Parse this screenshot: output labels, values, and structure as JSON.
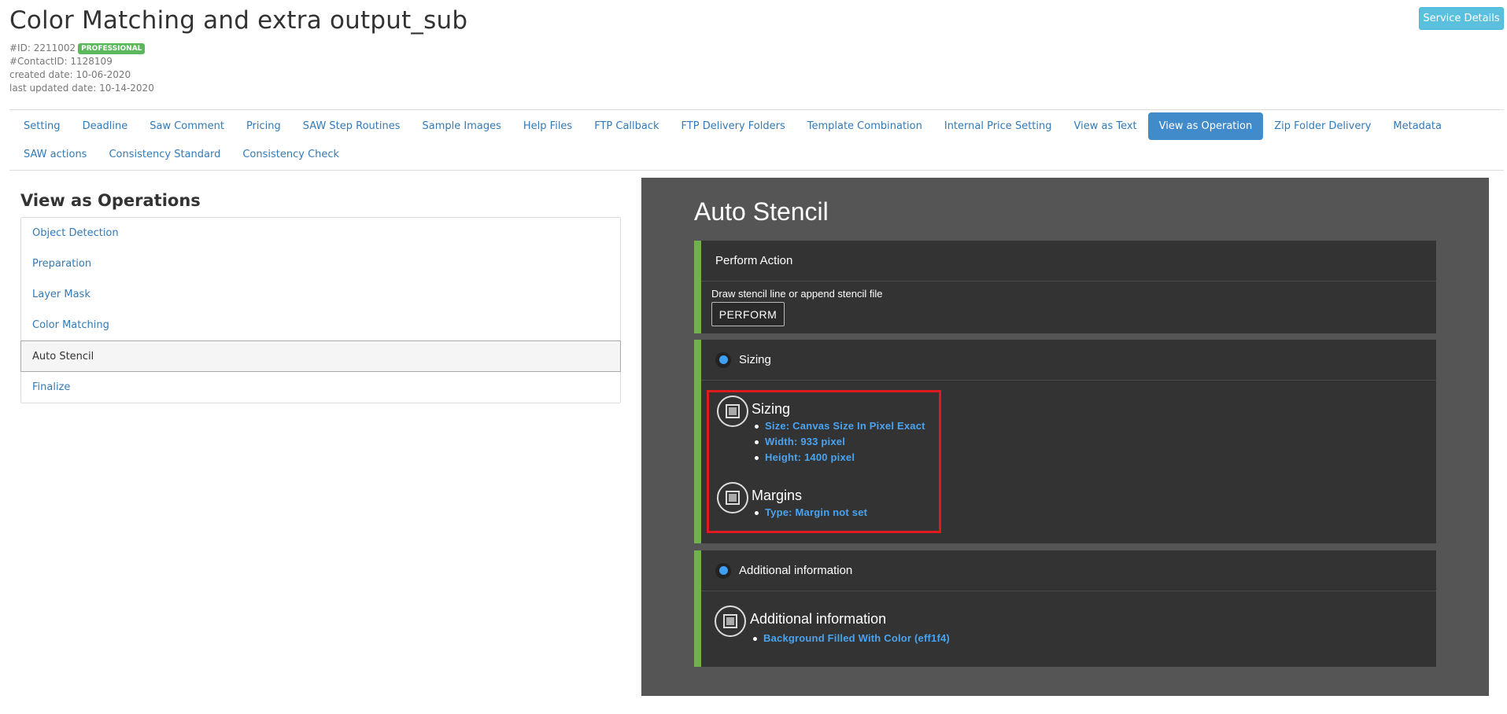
{
  "header": {
    "title": "Color Matching and extra output_sub",
    "id_line": "#ID: 2211002",
    "badge": "PROFESSIONAL",
    "contact_line": "#ContactID: 1128109",
    "created_line": "created date: 10-06-2020",
    "updated_line": "last updated date: 10-14-2020",
    "service_button": "Service Details"
  },
  "tabs": [
    {
      "label": "Setting"
    },
    {
      "label": "Deadline"
    },
    {
      "label": "Saw Comment"
    },
    {
      "label": "Pricing"
    },
    {
      "label": "SAW Step Routines"
    },
    {
      "label": "Sample Images"
    },
    {
      "label": "Help Files"
    },
    {
      "label": "FTP Callback"
    },
    {
      "label": "FTP Delivery Folders"
    },
    {
      "label": "Template Combination"
    },
    {
      "label": "Internal Price Setting"
    },
    {
      "label": "View as Text"
    },
    {
      "label": "View as Operation"
    },
    {
      "label": "Zip Folder Delivery"
    },
    {
      "label": "Metadata"
    },
    {
      "label": "SAW actions"
    },
    {
      "label": "Consistency Standard"
    },
    {
      "label": "Consistency Check"
    }
  ],
  "active_tab": "View as Operation",
  "operations": {
    "title": "View as Operations",
    "items": [
      {
        "label": "Object Detection"
      },
      {
        "label": "Preparation"
      },
      {
        "label": "Layer Mask"
      },
      {
        "label": "Color Matching"
      },
      {
        "label": "Auto Stencil"
      },
      {
        "label": "Finalize"
      }
    ],
    "active": "Auto Stencil"
  },
  "detail": {
    "title": "Auto Stencil",
    "perform_card": {
      "header": "Perform Action",
      "description": "Draw stencil line or append stencil file",
      "button": "PERFORM"
    },
    "sizing_card": {
      "header": "Sizing",
      "sections": [
        {
          "title": "Sizing",
          "items": [
            "Size: Canvas Size In Pixel Exact",
            "Width: 933 pixel",
            "Height: 1400 pixel"
          ]
        },
        {
          "title": "Margins",
          "items": [
            "Type: Margin not set"
          ]
        }
      ]
    },
    "info_card": {
      "header": "Additional information",
      "section_title": "Additional information",
      "items": [
        "Background Filled With Color (eff1f4)"
      ]
    }
  },
  "colors": {
    "accent_green": "#6fb24c",
    "active_tab": "#428bca",
    "highlight_red": "#e0191f",
    "link_blue": "#337ab7"
  }
}
